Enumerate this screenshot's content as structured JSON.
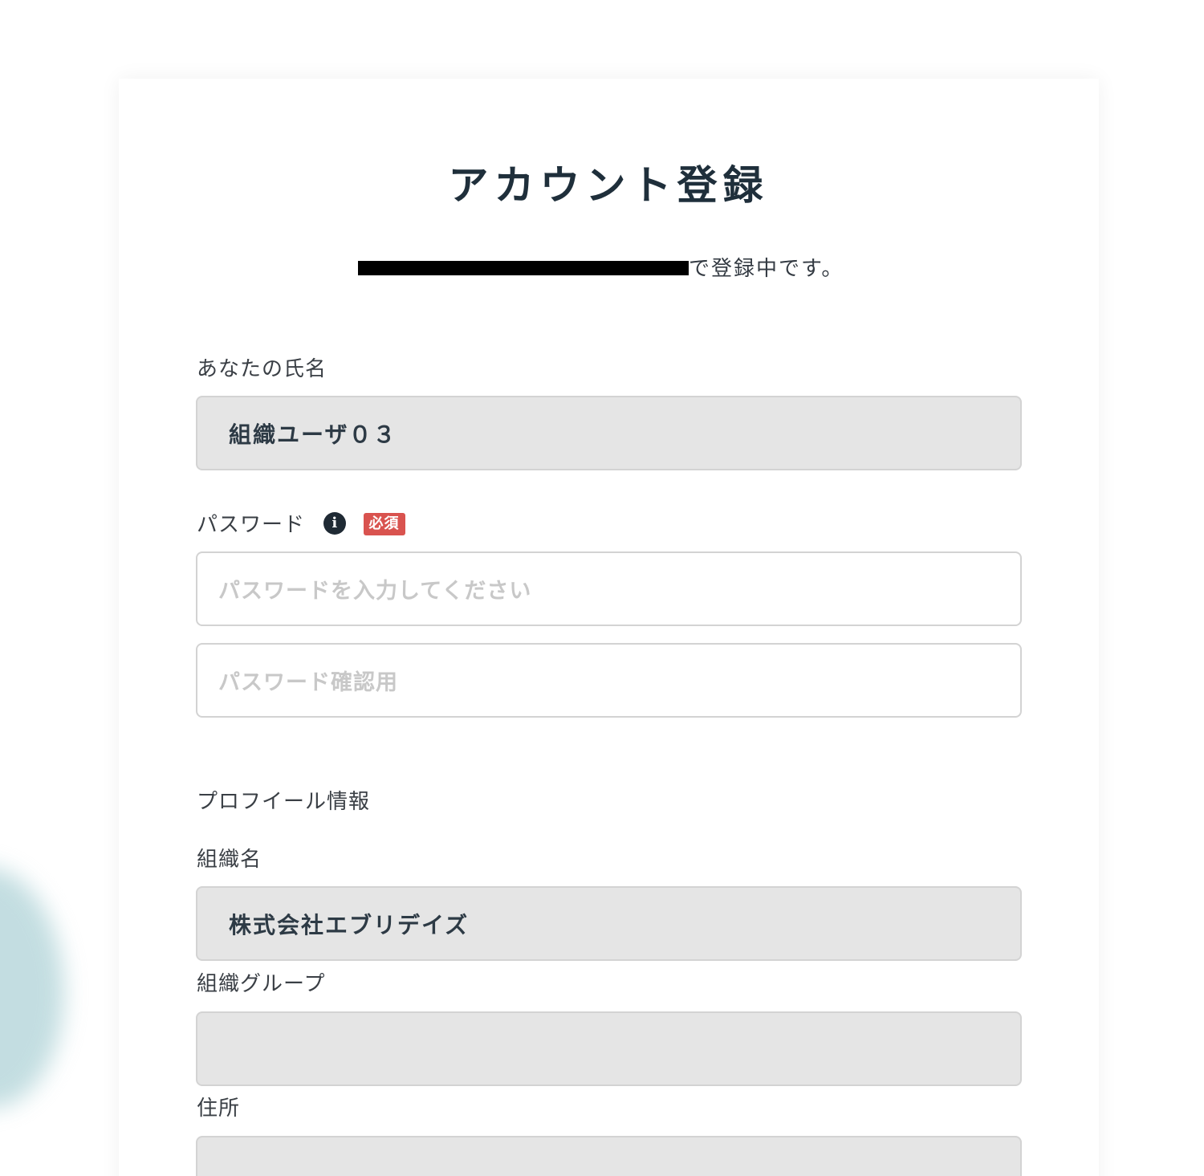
{
  "header": {
    "title": "アカウント登録",
    "registering_suffix": "で登録中です。"
  },
  "form": {
    "name": {
      "label": "あなたの氏名",
      "value": "組織ユーザ０３"
    },
    "password": {
      "label": "パスワード",
      "info_icon": "info-circle-icon",
      "required_badge": "必須",
      "placeholder": "パスワードを入力してください",
      "confirm_placeholder": "パスワード確認用"
    },
    "profile_section_title": "プロフイール情報",
    "organization": {
      "label": "組織名",
      "value": "株式会社エブリデイズ"
    },
    "organization_group": {
      "label": "組織グループ",
      "value": ""
    },
    "address": {
      "label": "住所",
      "value": ""
    }
  },
  "colors": {
    "required_badge": "#d9534f",
    "readonly_field_bg": "#e5e5e5",
    "title_text": "#1f2f3b"
  }
}
